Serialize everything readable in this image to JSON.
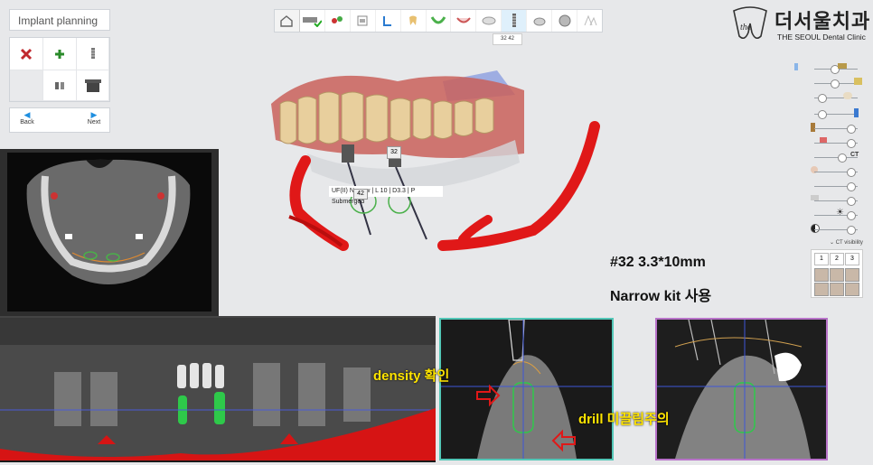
{
  "left_panel": {
    "title": "Implant planning",
    "back_label": "Back",
    "next_label": "Next"
  },
  "toolbar": {
    "icons": [
      "home-icon",
      "scan-icon",
      "model-icon",
      "crown-icon",
      "nerve-icon",
      "arch-icon",
      "tooth-icon",
      "bone-icon",
      "implant-icon",
      "abutment-icon",
      "guide-icon",
      "export-icon"
    ],
    "tooltip": "32    42"
  },
  "logo": {
    "mark": "the",
    "ko": "더서울치과",
    "en": "THE SEOUL Dental Clinic"
  },
  "right_panel": {
    "ct_label": "CT",
    "ct_visibility": "CT visibility",
    "view_numbers": [
      "1",
      "2",
      "3"
    ]
  },
  "main_view": {
    "implant_tag_32": "32",
    "implant_tag_42": "42",
    "implant_label": "UF(II) Narrow | L 10 | D3.3 | P Submerged",
    "note_line1": "#32 3.3*10mm",
    "note_line2": "Narrow kit 사용"
  },
  "ct_notes": {
    "density": "density 확인",
    "drill": "drill 미끌림주의"
  },
  "colors": {
    "accent_blue": "#1f8fe0",
    "nerve_red": "#e01818",
    "cs1_border": "#53c7b7",
    "cs2_border": "#b873c9",
    "note_yellow": "#ffe400"
  }
}
